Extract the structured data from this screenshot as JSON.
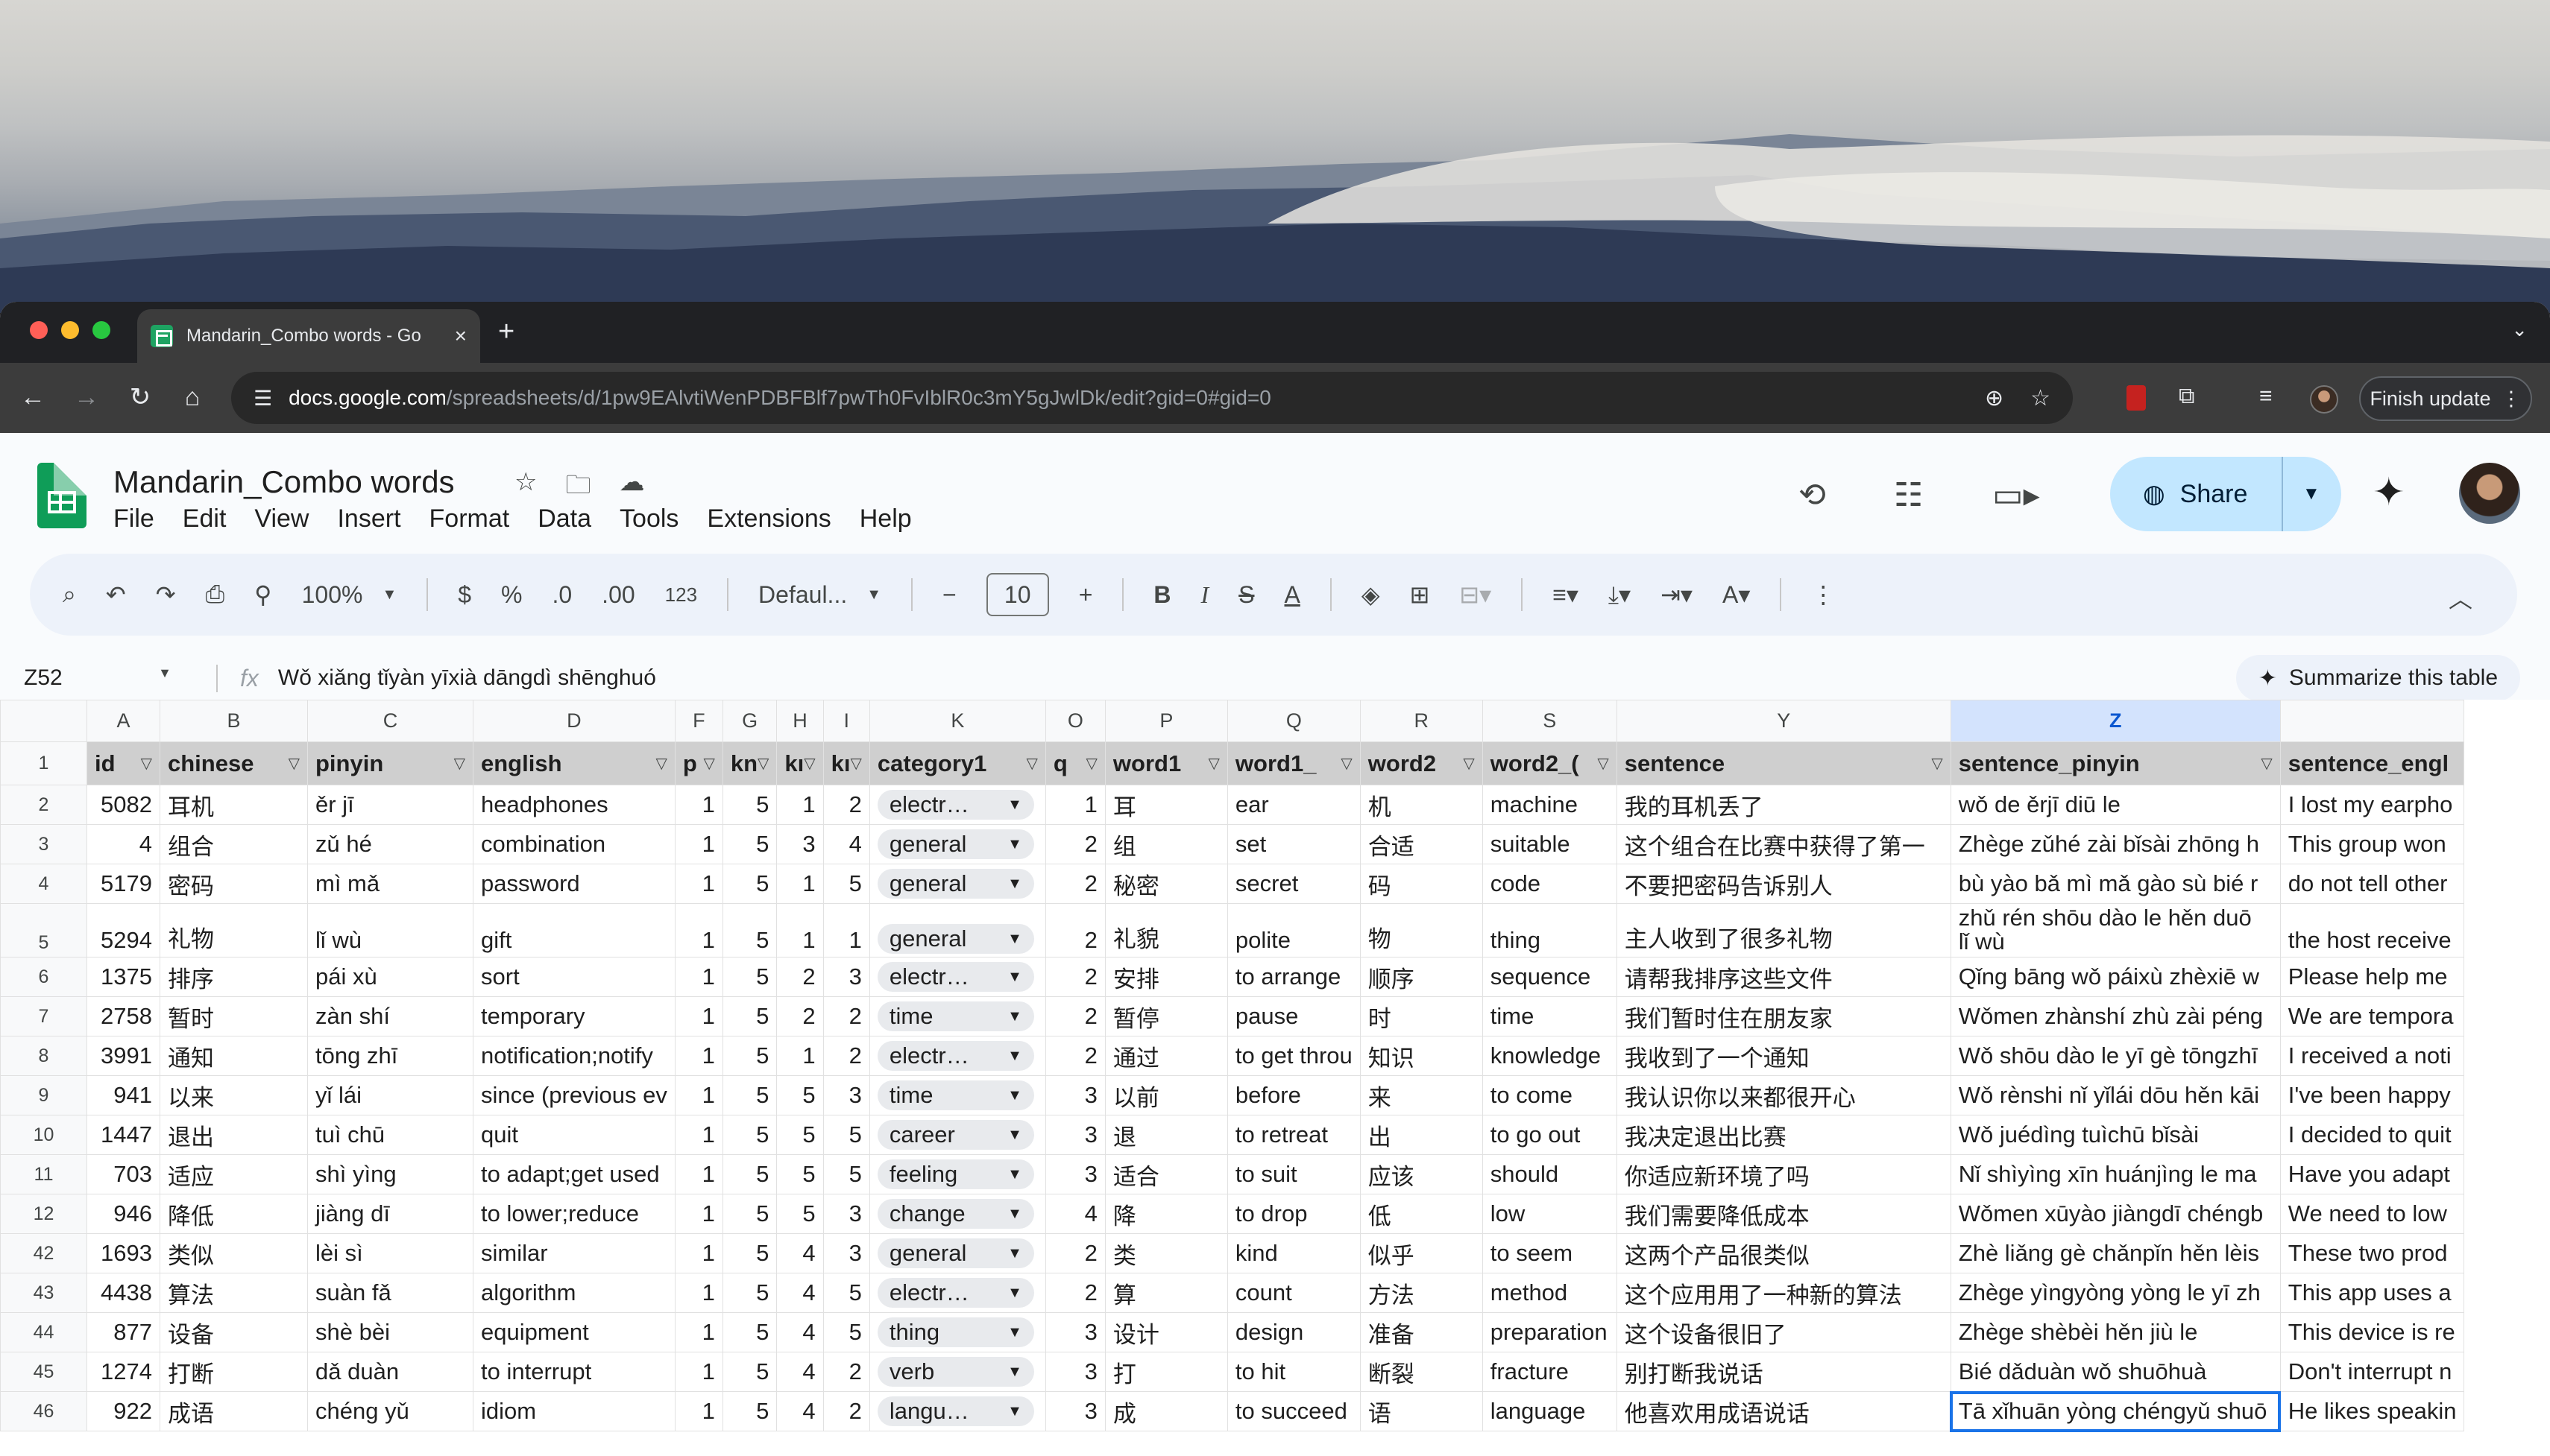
{
  "browser": {
    "tab_title": "Mandarin_Combo words - Go",
    "url_host": "docs.google.com",
    "url_rest": "/spreadsheets/d/1pw9EAlvtiWenPDBFBlf7pwTh0FvIblR0c3mY5gJwlDk/edit?gid=0#gid=0",
    "finish_update": "Finish update"
  },
  "sheet": {
    "title": "Mandarin_Combo words",
    "menu": [
      "File",
      "Edit",
      "View",
      "Insert",
      "Format",
      "Data",
      "Tools",
      "Extensions",
      "Help"
    ],
    "share_label": "Share",
    "zoom": "100%",
    "currency": "$",
    "percent": "%",
    "dec_dec": ".0",
    "dec_inc": ".00",
    "numfmt": "123",
    "font": "Defaul...",
    "font_size": "10",
    "namebox": "Z52",
    "formula": "Wǒ xiǎng tǐyàn yīxià dāngdì shēnghuó",
    "summarize": "Summarize this table"
  },
  "columns": [
    "A",
    "B",
    "C",
    "D",
    "F",
    "G",
    "H",
    "I",
    "K",
    "O",
    "P",
    "Q",
    "R",
    "S",
    "Y",
    "Z",
    ""
  ],
  "headers": [
    "id",
    "chinese",
    "pinyin",
    "english",
    "p",
    "kn",
    "kı",
    "kı",
    "category1",
    "q",
    "word1",
    "word1_",
    "word2",
    "word2_(",
    "sentence",
    "sentence_pinyin",
    "sentence_engl"
  ],
  "rows": [
    {
      "n": "2",
      "c": [
        "5082",
        "耳机",
        "ěr jī",
        "headphones",
        "1",
        "5",
        "1",
        "2",
        "electr…",
        "1",
        "耳",
        "ear",
        "机",
        "machine",
        "我的耳机丢了",
        "wǒ de ěrjī diū le",
        "I lost my earpho"
      ]
    },
    {
      "n": "3",
      "c": [
        "4",
        "组合",
        "zǔ hé",
        "combination",
        "1",
        "5",
        "3",
        "4",
        "general",
        "2",
        "组",
        "set",
        "合适",
        "suitable",
        "这个组合在比赛中获得了第一",
        "Zhège zǔhé zài bǐsài zhōng h",
        "This group won"
      ]
    },
    {
      "n": "4",
      "c": [
        "5179",
        "密码",
        "mì mǎ",
        "password",
        "1",
        "5",
        "1",
        "5",
        "general",
        "2",
        "秘密",
        "secret",
        "码",
        "code",
        "不要把密码告诉别人",
        "bù yào bǎ mì mǎ gào sù bié r",
        "do not tell other"
      ]
    },
    {
      "n": "5",
      "tall": true,
      "pinyin_top": "zhǔ rén shōu dào le hěn duō",
      "c": [
        "5294",
        "礼物",
        "lǐ wù",
        "gift",
        "1",
        "5",
        "1",
        "1",
        "general",
        "2",
        "礼貌",
        "polite",
        "物",
        "thing",
        "主人收到了很多礼物",
        "lǐ wù",
        "the host receive"
      ]
    },
    {
      "n": "6",
      "c": [
        "1375",
        "排序",
        "pái xù",
        "sort",
        "1",
        "5",
        "2",
        "3",
        "electr…",
        "2",
        "安排",
        "to arrange",
        "顺序",
        "sequence",
        "请帮我排序这些文件",
        "Qǐng bāng wǒ páixù zhèxiē w",
        "Please help me"
      ]
    },
    {
      "n": "7",
      "c": [
        "2758",
        "暂时",
        "zàn shí",
        "temporary",
        "1",
        "5",
        "2",
        "2",
        "time",
        "2",
        "暂停",
        "pause",
        "时",
        "time",
        "我们暂时住在朋友家",
        "Wǒmen zhànshí zhù zài péng",
        "We are tempora"
      ]
    },
    {
      "n": "8",
      "c": [
        "3991",
        "通知",
        "tōng zhī",
        "notification;notify",
        "1",
        "5",
        "1",
        "2",
        "electr…",
        "2",
        "通过",
        "to get throu",
        "知识",
        "knowledge",
        "我收到了一个通知",
        "Wǒ shōu dào le yī gè tōngzhī",
        "I received a noti"
      ]
    },
    {
      "n": "9",
      "c": [
        "941",
        "以来",
        "yǐ lái",
        "since (previous ev",
        "1",
        "5",
        "5",
        "3",
        "time",
        "3",
        "以前",
        "before",
        "来",
        "to come",
        "我认识你以来都很开心",
        "Wǒ rènshi nǐ yǐlái dōu hěn kāi",
        "I've been happy"
      ]
    },
    {
      "n": "10",
      "c": [
        "1447",
        "退出",
        "tuì chū",
        "quit",
        "1",
        "5",
        "5",
        "5",
        "career",
        "3",
        "退",
        "to retreat",
        "出",
        "to go out",
        "我决定退出比赛",
        "Wǒ juédìng tuìchū bǐsài",
        "I decided to quit"
      ]
    },
    {
      "n": "11",
      "c": [
        "703",
        "适应",
        "shì yìng",
        "to adapt;get used",
        "1",
        "5",
        "5",
        "5",
        "feeling",
        "3",
        "适合",
        "to suit",
        "应该",
        "should",
        "你适应新环境了吗",
        "Nǐ shìyìng xīn huánjìng le ma",
        "Have you adapt"
      ]
    },
    {
      "n": "12",
      "c": [
        "946",
        "降低",
        "jiàng dī",
        "to lower;reduce",
        "1",
        "5",
        "5",
        "3",
        "change",
        "4",
        "降",
        "to drop",
        "低",
        "low",
        "我们需要降低成本",
        "Wǒmen xūyào jiàngdī chéngb",
        "We need to low"
      ]
    },
    {
      "n": "42",
      "c": [
        "1693",
        "类似",
        "lèi sì",
        "similar",
        "1",
        "5",
        "4",
        "3",
        "general",
        "2",
        "类",
        "kind",
        "似乎",
        "to seem",
        "这两个产品很类似",
        "Zhè liǎng gè chǎnpǐn hěn lèis",
        "These two prod"
      ]
    },
    {
      "n": "43",
      "c": [
        "4438",
        "算法",
        "suàn fǎ",
        "algorithm",
        "1",
        "5",
        "4",
        "5",
        "electr…",
        "2",
        "算",
        "count",
        "方法",
        "method",
        "这个应用用了一种新的算法",
        "Zhège yìngyòng yòng le yī zh",
        "This app uses a"
      ]
    },
    {
      "n": "44",
      "c": [
        "877",
        "设备",
        "shè bèi",
        "equipment",
        "1",
        "5",
        "4",
        "5",
        "thing",
        "3",
        "设计",
        "design",
        "准备",
        "preparation",
        "这个设备很旧了",
        "Zhège shèbèi hěn jiù le",
        "This device is re"
      ]
    },
    {
      "n": "45",
      "c": [
        "1274",
        "打断",
        "dǎ duàn",
        "to interrupt",
        "1",
        "5",
        "4",
        "2",
        "verb",
        "3",
        "打",
        "to hit",
        "断裂",
        "fracture",
        "别打断我说话",
        "Bié dǎduàn wǒ shuōhuà",
        "Don't interrupt n"
      ]
    },
    {
      "n": "46",
      "c": [
        "922",
        "成语",
        "chéng yǔ",
        "idiom",
        "1",
        "5",
        "4",
        "2",
        "langu…",
        "3",
        "成",
        "to succeed",
        "语",
        "language",
        "他喜欢用成语说话",
        "Tā xǐhuān yòng chéngyǔ shuō",
        "He likes speakin"
      ]
    }
  ],
  "colors": {
    "accent": "#0b57d0",
    "share_bg": "#c2e7ff",
    "selection": "#1a73e8"
  }
}
